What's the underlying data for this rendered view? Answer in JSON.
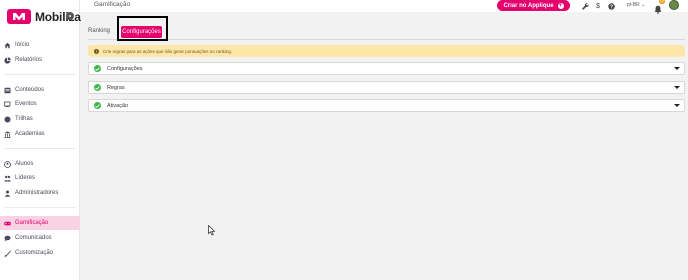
{
  "app": {
    "name": "Mobiliza"
  },
  "header": {
    "title": "Gamificação",
    "cta_label": "Criar no Applique",
    "language": "pt-BR",
    "notification_count": "12"
  },
  "sidebar": {
    "groups": [
      [
        {
          "label": "Início",
          "icon": "home-icon"
        },
        {
          "label": "Relatórios",
          "icon": "chart-pie-icon"
        }
      ],
      [
        {
          "label": "Conteúdos",
          "icon": "content-icon"
        },
        {
          "label": "Eventos",
          "icon": "events-icon"
        },
        {
          "label": "Trilhas",
          "icon": "trails-icon"
        },
        {
          "label": "Academias",
          "icon": "academy-icon"
        }
      ],
      [
        {
          "label": "Alunos",
          "icon": "user-icon"
        },
        {
          "label": "Líderes",
          "icon": "leaders-icon"
        },
        {
          "label": "Administradores",
          "icon": "admin-icon"
        }
      ],
      [
        {
          "label": "Gamificação",
          "icon": "gamepad-icon",
          "active": true
        },
        {
          "label": "Comunicados",
          "icon": "chat-icon"
        },
        {
          "label": "Customização",
          "icon": "brush-icon"
        }
      ]
    ]
  },
  "tabs": {
    "ranking": "Ranking",
    "config": "Configurações"
  },
  "alert": {
    "text": "Crie regras para as ações que irão gerar pontuações no ranking."
  },
  "sections": [
    {
      "label": "Configurações"
    },
    {
      "label": "Regras"
    },
    {
      "label": "Ativação"
    }
  ],
  "colors": {
    "brand": "#e5006d",
    "active_bg": "#f9d3e4",
    "alert_bg": "#fde7a8",
    "success": "#3cb54a"
  }
}
